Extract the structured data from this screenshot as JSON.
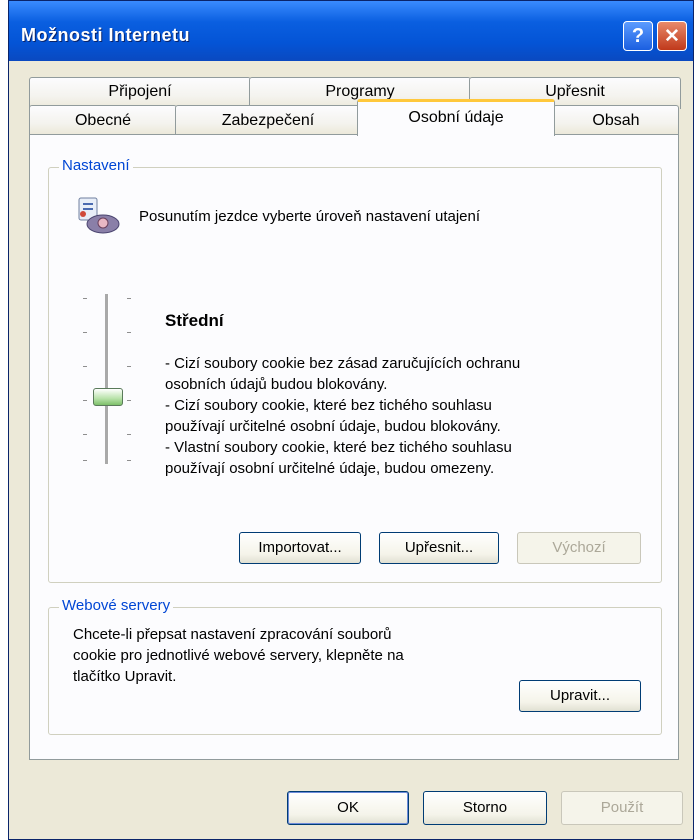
{
  "window": {
    "title": "Možnosti Internetu"
  },
  "titlebar_buttons": {
    "help": "?",
    "close": "✕"
  },
  "tabs": {
    "row_back": [
      "Připojení",
      "Programy",
      "Upřesnit"
    ],
    "row_front": [
      "Obecné",
      "Zabezpečení",
      "Osobní údaje",
      "Obsah"
    ],
    "active": "Osobní údaje"
  },
  "settings": {
    "legend": "Nastavení",
    "description": "Posunutím jezdce vyberte úroveň nastavení utajení",
    "level_title": "Střední",
    "level_lines": [
      "- Cizí soubory cookie bez zásad zaručujících ochranu",
      "osobních údajů budou blokovány.",
      "- Cizí soubory cookie, které bez tichého souhlasu",
      "používají určitelné osobní údaje, budou blokovány.",
      "- Vlastní soubory cookie, které bez tichého souhlasu",
      "používají osobní určitelné údaje, budou omezeny."
    ],
    "slider_level": "Střední",
    "buttons": {
      "import": "Importovat...",
      "advanced": "Upřesnit...",
      "default": "Výchozí"
    }
  },
  "web_servers": {
    "legend": "Webové servery",
    "lines": [
      "Chcete-li přepsat nastavení zpracování souborů",
      "cookie pro jednotlivé webové servery, klepněte na",
      "tlačítko Upravit."
    ],
    "edit_button": "Upravit..."
  },
  "footer": {
    "ok": "OK",
    "cancel": "Storno",
    "apply": "Použít"
  }
}
